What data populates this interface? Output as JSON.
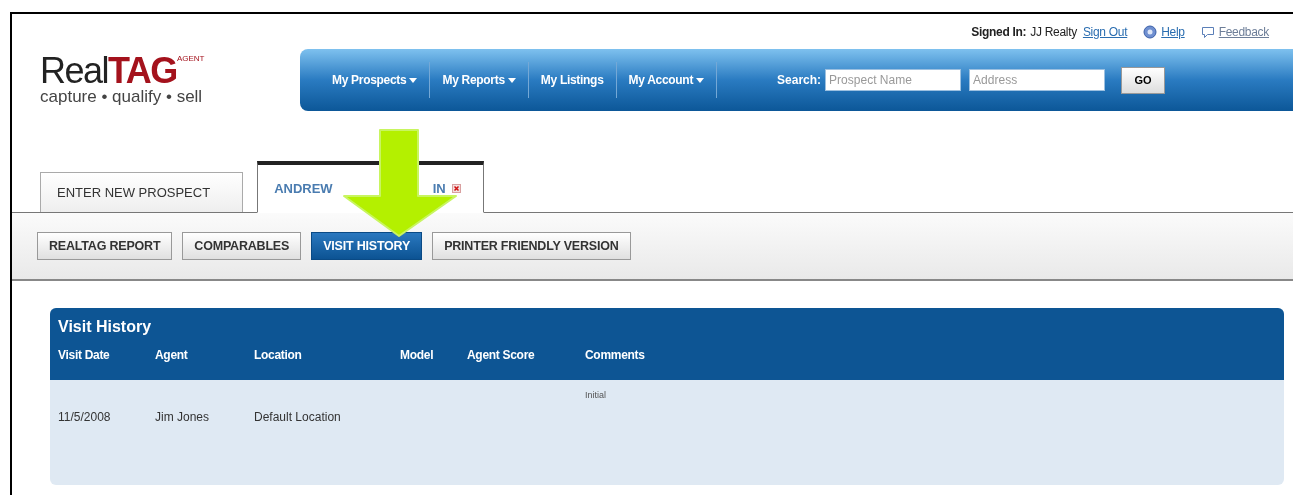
{
  "user_bar": {
    "signed_in_label": "Signed In:",
    "account": "JJ Realty",
    "sign_out": "Sign Out",
    "help": "Help",
    "feedback": "Feedback"
  },
  "logo": {
    "word_plain": "Real",
    "word_bold": "TAG",
    "superscript": "AGENT",
    "tagline": "capture • qualify • sell"
  },
  "nav": {
    "items": [
      {
        "label": "My Prospects",
        "dropdown": true
      },
      {
        "label": "My Reports",
        "dropdown": true
      },
      {
        "label": "My Listings",
        "dropdown": false
      },
      {
        "label": "My Account",
        "dropdown": true
      }
    ],
    "search_label": "Search:",
    "search_fields": [
      {
        "placeholder": "Prospect Name"
      },
      {
        "placeholder": "Address"
      }
    ],
    "go": "GO"
  },
  "tabs": [
    {
      "label": "ENTER NEW PROSPECT",
      "selected": false,
      "closable": false
    },
    {
      "label": "ANDREW",
      "label_tail": "IN",
      "selected": true,
      "closable": true
    }
  ],
  "subtabs": [
    {
      "label": "REALTAG REPORT",
      "selected": false
    },
    {
      "label": "COMPARABLES",
      "selected": false
    },
    {
      "label": "VISIT HISTORY",
      "selected": true
    },
    {
      "label": "PRINTER FRIENDLY VERSION",
      "selected": false
    }
  ],
  "panel": {
    "title": "Visit History",
    "columns": [
      "Visit Date",
      "Agent",
      "Location",
      "Model",
      "Agent Score",
      "Comments"
    ],
    "rows": [
      [
        "11/5/2008",
        "Jim Jones",
        "Default Location",
        "",
        "",
        "Initial"
      ]
    ]
  }
}
